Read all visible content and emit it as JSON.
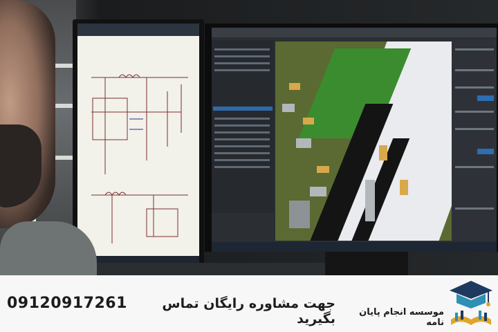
{
  "banner": {
    "phone": "09120917261",
    "call_to_action": "جهت مشاوره رایگان تماس بگیرید",
    "brand_name": "موسسه انجام پایان نامه"
  },
  "colors": {
    "banner_bg": "#f7f7f7",
    "text": "#1c1c1c",
    "logo_navy": "#1f3a5f",
    "logo_teal": "#2f8fb5",
    "logo_gold": "#e0a52a"
  },
  "photo": {
    "subject": "person-viewing-pcb-design-monitors",
    "icons": [
      "graduation-cap-logo-icon"
    ]
  }
}
